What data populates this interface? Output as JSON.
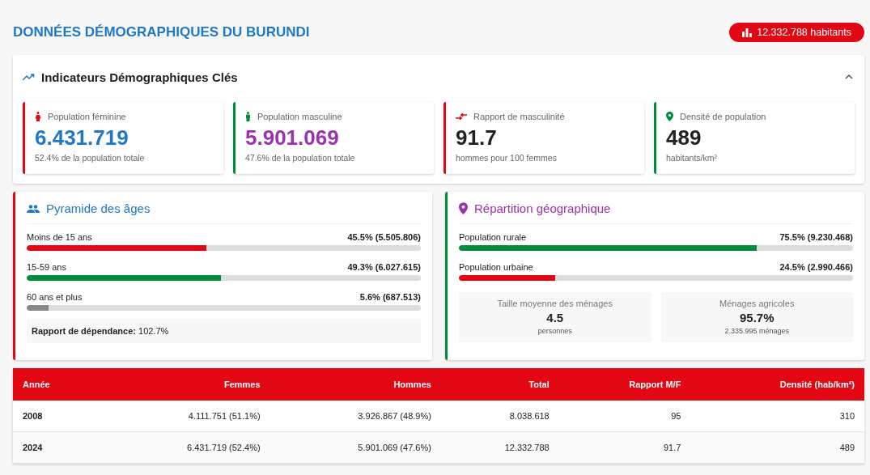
{
  "header": {
    "title": "DONNÉES DÉMOGRAPHIQUES DU BURUNDI",
    "badge": "12.332.788 habitants"
  },
  "indicators": {
    "title": "Indicateurs Démographiques Clés",
    "expanded": true,
    "cards": [
      {
        "label": "Population féminine",
        "value": "6.431.719",
        "note": "52.4% de la population totale"
      },
      {
        "label": "Population masculine",
        "value": "5.901.069",
        "note": "47.6% de la population totale"
      },
      {
        "label": "Rapport de masculinité",
        "value": "91.7",
        "note": "hommes pour 100 femmes"
      },
      {
        "label": "Densité de population",
        "value": "489",
        "note": "habitants/km²"
      }
    ]
  },
  "age_pyramid": {
    "title": "Pyramide des âges",
    "bars": [
      {
        "label": "Moins de 15 ans",
        "reading": "45.5% (5.505.806)",
        "level": 0.455,
        "color": "#e30613"
      },
      {
        "label": "15-59 ans",
        "reading": "49.3% (6.027.615)",
        "level": 0.493,
        "color": "#008c3a"
      },
      {
        "label": "60 ans et plus",
        "reading": "5.6% (687.513)",
        "level": 0.056,
        "color": "#888888"
      }
    ],
    "dependency_label": "Rapport de dépendance:",
    "dependency_value": "102.7%"
  },
  "geo": {
    "title": "Répartition géographique",
    "bars": [
      {
        "label": "Population rurale",
        "reading": "75.5% (9.230.468)",
        "level": 0.755,
        "color": "#008c3a"
      },
      {
        "label": "Population urbaine",
        "reading": "24.5% (2.990.466)",
        "level": 0.245,
        "color": "#e30613"
      }
    ],
    "stats": [
      {
        "label": "Taille moyenne des ménages",
        "value": "4.5",
        "note": "personnes"
      },
      {
        "label": "Ménages agricoles",
        "value": "95.7%",
        "note": "2.335.995 ménages"
      }
    ]
  },
  "table": {
    "columns": [
      "Année",
      "Femmes",
      "Hommes",
      "Total",
      "Rapport M/F",
      "Densité (hab/km²)"
    ],
    "rows": [
      [
        "2008",
        "4.111.751 (51.1%)",
        "3.926.867 (48.9%)",
        "8.038.618",
        "95",
        "310"
      ],
      [
        "2024",
        "6.431.719 (52.4%)",
        "5.901.069 (47.6%)",
        "12.332.788",
        "91.7",
        "489"
      ]
    ]
  }
}
